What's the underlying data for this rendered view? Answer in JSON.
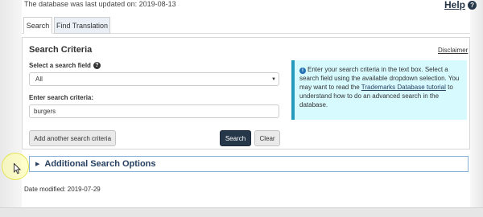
{
  "header": {
    "last_updated": "The database was last updated on: 2019-08-13",
    "help_label": "Help",
    "help_icon": "question-circle-icon"
  },
  "tabs": [
    {
      "label": "Search",
      "active": true
    },
    {
      "label": "Find Translation",
      "active": false
    }
  ],
  "search_panel": {
    "title": "Search Criteria",
    "disclaimer": "Disclaimer",
    "field_label": "Select a search field",
    "field_help_icon": "question-circle-icon",
    "field_value": "All",
    "criteria_label": "Enter search criteria:",
    "criteria_value": "burgers",
    "add_button": "Add another search criteria",
    "search_button": "Search",
    "clear_button": "Clear"
  },
  "info_box": {
    "icon": "info-circle-icon",
    "text_before": "Enter your search criteria in the text box. Select a search field using the available dropdown selection. You may want to read the ",
    "link_text": "Trademarks Database tutorial",
    "text_after": " to understand how to do an advanced search in the database.",
    "accent_color": "#269abc",
    "background_color": "#d7faff"
  },
  "additional_options": {
    "arrow_icon": "triangle-right-icon",
    "label": "Additional Search Options"
  },
  "footer": {
    "date_modified": "Date modified: 2019-07-29"
  },
  "colors": {
    "primary_button": "#26374a",
    "link": "#284162"
  }
}
